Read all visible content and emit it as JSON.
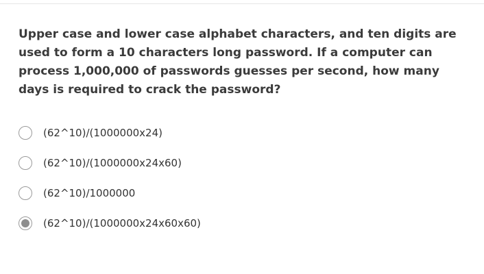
{
  "question": {
    "text": "Upper case and lower case alphabet characters, and ten digits are used to form a 10 characters long password. If a computer can process 1,000,000 of passwords guesses per second, how many days is required to crack the password?"
  },
  "options": [
    {
      "label": "(62^10)/(1000000x24)",
      "selected": false
    },
    {
      "label": "(62^10)/(1000000x24x60)",
      "selected": false
    },
    {
      "label": "(62^10)/1000000",
      "selected": false
    },
    {
      "label": "(62^10)/(1000000x24x60x60)",
      "selected": true
    }
  ]
}
